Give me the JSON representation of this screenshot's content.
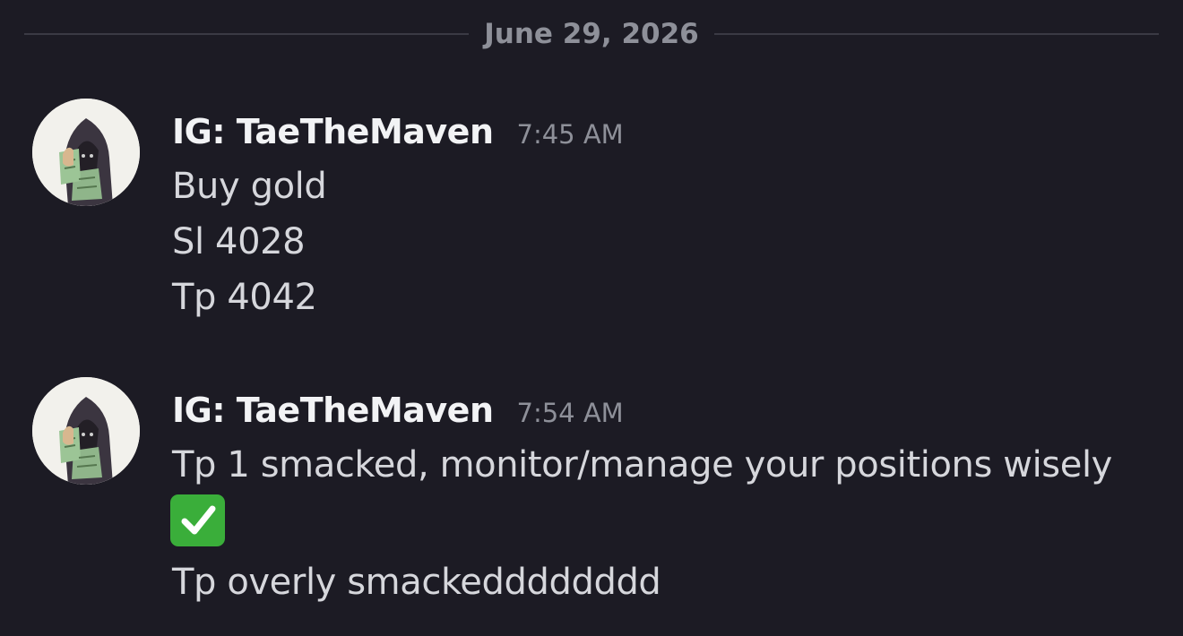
{
  "date_divider": "June 29, 2026",
  "messages": [
    {
      "author": "IG: TaeTheMaven",
      "time": "7:45 AM",
      "lines": [
        "Buy gold",
        "Sl 4028",
        "Tp 4042"
      ]
    },
    {
      "author": "IG: TaeTheMaven",
      "time": "7:54 AM",
      "lines": [
        "Tp 1 smacked, monitor/manage your positions wisely",
        "Tp overly smackedddddddd"
      ],
      "emoji": "check-mark-button"
    }
  ],
  "colors": {
    "background": "#1c1b24",
    "username": "#f2f3f5",
    "message_text": "#d6d7dc",
    "muted": "#8e9099",
    "divider": "#3a3a44",
    "emoji_green": "#3aae3a"
  }
}
